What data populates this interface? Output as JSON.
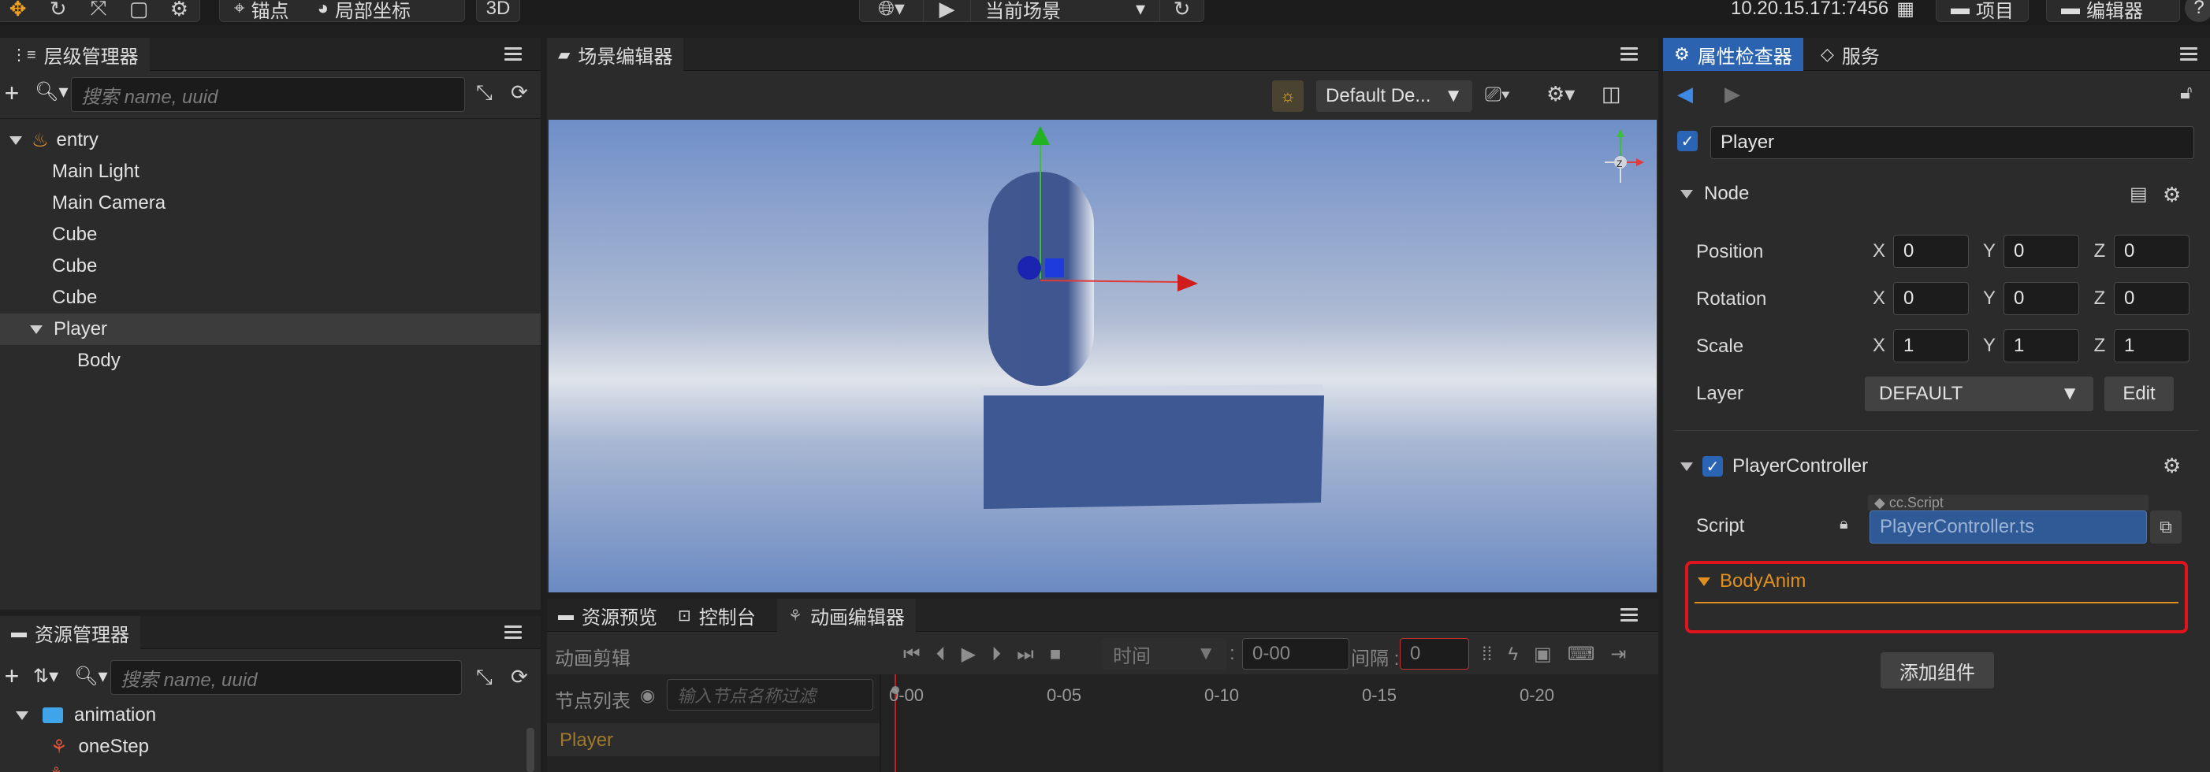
{
  "toolbar": {
    "anchor_label": "锚点",
    "local_coord_label": "局部坐标",
    "mode_3d": "3D",
    "scene_select": "当前场景",
    "server_address": "10.20.15.171:7456",
    "project_label": "项目",
    "editor_label": "编辑器"
  },
  "hierarchy": {
    "title": "层级管理器",
    "search_placeholder": "搜索 name, uuid",
    "items": [
      {
        "label": "entry"
      },
      {
        "label": "Main Light"
      },
      {
        "label": "Main Camera"
      },
      {
        "label": "Cube"
      },
      {
        "label": "Cube"
      },
      {
        "label": "Cube"
      },
      {
        "label": "Player"
      },
      {
        "label": "Body"
      }
    ]
  },
  "assets": {
    "title": "资源管理器",
    "search_placeholder": "搜索 name, uuid",
    "items": [
      {
        "label": "animation"
      },
      {
        "label": "oneStep"
      }
    ]
  },
  "scene_editor": {
    "title": "场景编辑器",
    "camera_select": "Default De...",
    "gizmo_axis_label": "Z",
    "colors": {
      "sky_top": "#6f8ec8",
      "sky_mid": "#dfe3ea",
      "sky_bottom": "#6b8ac2",
      "mesh": "#3e5893"
    }
  },
  "bottom": {
    "tabs": [
      {
        "label": "资源预览"
      },
      {
        "label": "控制台"
      },
      {
        "label": "动画编辑器"
      }
    ],
    "clip_label": "动画剪辑",
    "time_select": "时间",
    "time_value": "0-00",
    "interval_label": "间隔 :",
    "interval_value": "0",
    "node_list_label": "节点列表",
    "node_filter_placeholder": "输入节点名称过滤",
    "ruler": [
      "0-00",
      "0-05",
      "0-10",
      "0-15",
      "0-20"
    ],
    "track_node": "Player"
  },
  "inspector": {
    "tab_label": "属性检查器",
    "service_tab": "服务",
    "node_name": "Player",
    "node_section": "Node",
    "position": {
      "label": "Position",
      "x": "0",
      "y": "0",
      "z": "0"
    },
    "rotation": {
      "label": "Rotation",
      "x": "0",
      "y": "0",
      "z": "0"
    },
    "scale": {
      "label": "Scale",
      "x": "1",
      "y": "1",
      "z": "1"
    },
    "axes": {
      "x": "X",
      "y": "Y",
      "z": "Z"
    },
    "layer": {
      "label": "Layer",
      "value": "DEFAULT",
      "edit_label": "Edit"
    },
    "component": {
      "name": "PlayerController",
      "script_label": "Script",
      "script_type": "cc.Script",
      "script_value": "PlayerController.ts"
    },
    "body_anim_label": "BodyAnim",
    "add_component_label": "添加组件",
    "accent_color": "#e0901e",
    "highlight_color": "#e1141e"
  }
}
